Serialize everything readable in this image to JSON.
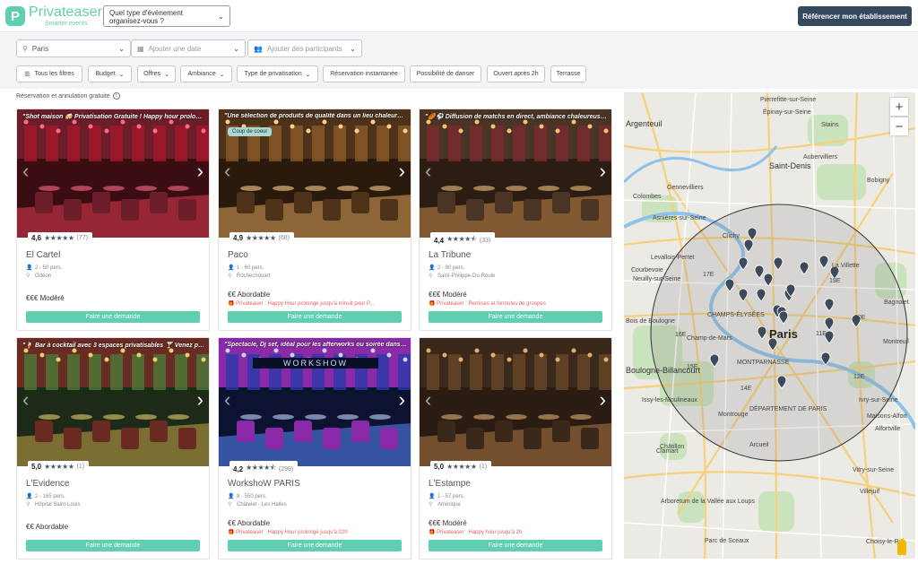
{
  "header": {
    "logo_letter": "P",
    "logo_name": "Privateaser",
    "logo_tagline": "Smarter events",
    "event_select_label": "Quel type d'évènement organisez-vous ?",
    "cta_label": "Référencer mon établissement"
  },
  "filters": {
    "location_value": "Paris",
    "date_placeholder": "Ajouter une date",
    "participants_placeholder": "Ajouter des participants",
    "chips": [
      {
        "label": "Tous les filtres"
      },
      {
        "label": "Budget"
      },
      {
        "label": "Offres"
      },
      {
        "label": "Ambiance"
      },
      {
        "label": "Type de privatisation"
      },
      {
        "label": "Réservation instantanée"
      },
      {
        "label": "Possibilité de danser"
      },
      {
        "label": "Ouvert après 2h"
      },
      {
        "label": "Terrasse"
      }
    ],
    "note": "Réservation et annulation gratuite"
  },
  "cards": [
    {
      "tagline": "\"Shot maison 🍻 Privatisation Gratuite ! Happy hour prolon...\"",
      "badge": "",
      "score": "4,6",
      "stars_fill": 5,
      "reviews": "(77)",
      "name": "El Cartel",
      "capacity": "2 - 50 pers.",
      "place": "Odéon",
      "price": "€€€ Modéré",
      "promo": "",
      "button": "Faire une demande",
      "palette": "red"
    },
    {
      "tagline": "\"Une sélection de produits de qualité dans un lieu chaleureu...\"",
      "badge": "Coup de coeur",
      "score": "4,9",
      "stars_fill": 5,
      "reviews": "(68)",
      "name": "Paco",
      "capacity": "1 - 60 pers.",
      "place": "Rochechouart",
      "price": "€€ Abordable",
      "promo": "Privateaser : Happy Hour prolongé jusqu'à minuit pour P...",
      "button": "Faire une demande",
      "palette": "warm"
    },
    {
      "tagline": "\"🏉⚽ Diffusion de matchs en direct, ambiance chaleureus...\"",
      "badge": "",
      "score": "4,4",
      "stars_fill": 4.5,
      "reviews": "(33)",
      "name": "La Tribune",
      "capacity": "2 - 80 pers.",
      "place": "Saint-Philippe-Du-Roule",
      "price": "€€€ Modéré",
      "promo": "Privateaser : Remises et formules de groupes",
      "button": "Faire une demande",
      "palette": "terrace"
    },
    {
      "tagline": "\"🍹 Bar à cocktail avec 3 espaces privatisables 🍸 Venez pr...\"",
      "badge": "",
      "score": "5,0",
      "stars_fill": 5,
      "reviews": "(1)",
      "name": "L'Evidence",
      "capacity": "2 - 165 pers.",
      "place": "Hôpital Saint-Louis",
      "price": "€€ Abordable",
      "promo": "",
      "button": "Faire une demande",
      "palette": "green"
    },
    {
      "tagline": "\"Spectacle, Dj set, idéal pour les afterworks ou soirée dansa...\"",
      "badge": "",
      "score": "4,2",
      "stars_fill": 4.5,
      "reviews": "(298)",
      "name": "WorkshoW PARIS",
      "capacity": "8 - 550 pers.",
      "place": "Châtelet - Les Halles",
      "price": "€€ Abordable",
      "promo": "Privateaser : Happy Hour prolongé jusqu'à 22h",
      "button": "Faire une demande",
      "palette": "blue",
      "sign": "WORKSHOW"
    },
    {
      "tagline": "",
      "badge": "",
      "score": "5,0",
      "stars_fill": 5,
      "reviews": "(1)",
      "name": "L'Estampe",
      "capacity": "1 - 57 pers.",
      "place": "Amérique",
      "price": "€€€ Modéré",
      "promo": "Privateaser : Happy hour jusqu'à 2h",
      "button": "Faire une demande",
      "palette": "brown"
    }
  ],
  "map": {
    "zoom_in": "+",
    "zoom_out": "−",
    "city_label": "Paris",
    "labels": [
      {
        "t": "Saint-Denis",
        "cls": "med"
      },
      {
        "t": "Argenteuil",
        "cls": "med"
      },
      {
        "t": "Pierrefitte-sur-Seine",
        "cls": ""
      },
      {
        "t": "Épinay-sur-Seine",
        "cls": ""
      },
      {
        "t": "Stains",
        "cls": ""
      },
      {
        "t": "Gennevilliers",
        "cls": ""
      },
      {
        "t": "Colombes",
        "cls": ""
      },
      {
        "t": "Asnières-sur-Seine",
        "cls": ""
      },
      {
        "t": "Clichy",
        "cls": ""
      },
      {
        "t": "Levallois-Perret",
        "cls": ""
      },
      {
        "t": "Courbevoie",
        "cls": ""
      },
      {
        "t": "Neuilly-sur-Seine",
        "cls": ""
      },
      {
        "t": "Bois de Boulogne",
        "cls": ""
      },
      {
        "t": "Champ-de-Mars",
        "cls": ""
      },
      {
        "t": "Boulogne-Billancourt",
        "cls": "med"
      },
      {
        "t": "Issy-les-Moulineaux",
        "cls": ""
      },
      {
        "t": "Montrouge",
        "cls": ""
      },
      {
        "t": "Châtillon",
        "cls": ""
      },
      {
        "t": "Clamart",
        "cls": ""
      },
      {
        "t": "Arcueil",
        "cls": ""
      },
      {
        "t": "Vitry-sur-Seine",
        "cls": ""
      },
      {
        "t": "Ivry-sur-Seine",
        "cls": ""
      },
      {
        "t": "La Villette",
        "cls": ""
      },
      {
        "t": "Bagnolet",
        "cls": ""
      },
      {
        "t": "Montreuil",
        "cls": ""
      },
      {
        "t": "Bobigny",
        "cls": ""
      },
      {
        "t": "Aubervilliers",
        "cls": ""
      },
      {
        "t": "Villejuif",
        "cls": ""
      },
      {
        "t": "Arboretum de la Vallée aux Loups",
        "cls": ""
      },
      {
        "t": "Choisy-le-Roi",
        "cls": ""
      },
      {
        "t": "Parc de Sceaux",
        "cls": ""
      },
      {
        "t": "Alfortville",
        "cls": ""
      },
      {
        "t": "Maisons-Alfort",
        "cls": ""
      },
      {
        "t": "DÉPARTEMENT DE PARIS",
        "cls": ""
      },
      {
        "t": "MONTPARNASSE",
        "cls": ""
      },
      {
        "t": "CHAMPS-ÉLYSÉES",
        "cls": ""
      },
      {
        "t": "17E",
        "cls": ""
      },
      {
        "t": "16E",
        "cls": ""
      },
      {
        "t": "15E",
        "cls": ""
      },
      {
        "t": "14E",
        "cls": ""
      },
      {
        "t": "12E",
        "cls": ""
      },
      {
        "t": "20E",
        "cls": ""
      },
      {
        "t": "19E",
        "cls": ""
      },
      {
        "t": "11E",
        "cls": ""
      }
    ]
  }
}
